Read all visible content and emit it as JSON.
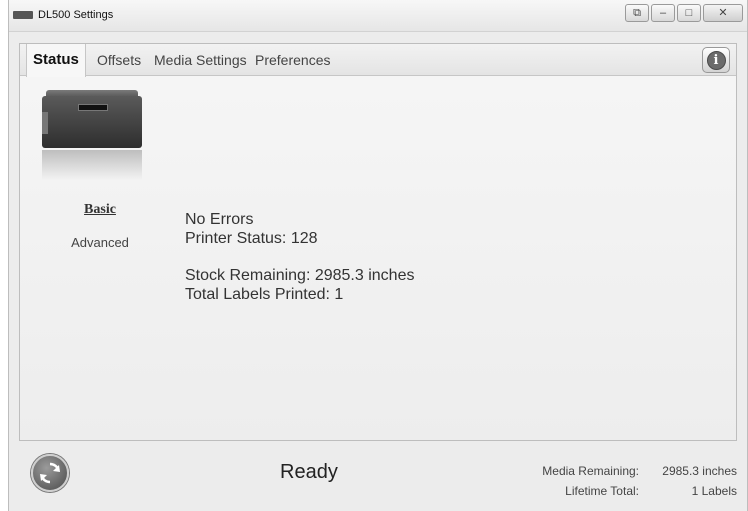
{
  "window": {
    "title": "DL500 Settings",
    "controls": {
      "restore": "⧉",
      "minimize": "–",
      "maximize": "□",
      "close": "✕"
    }
  },
  "tabs": [
    {
      "label": "Status",
      "active": true
    },
    {
      "label": "Offsets",
      "active": false
    },
    {
      "label": "Media Settings",
      "active": false
    },
    {
      "label": "Preferences",
      "active": false
    }
  ],
  "info_button": {
    "glyph": "i",
    "icon": "info-icon"
  },
  "printer_panel": {
    "image": "printer-image",
    "basic_link": "Basic",
    "advanced_link": "Advanced"
  },
  "status": {
    "errors": "No Errors",
    "printer_status": "Printer Status:  128",
    "stock_remaining": "Stock Remaining: 2985.3 inches",
    "total_labels": "Total Labels Printed:  1"
  },
  "footer": {
    "refresh_icon": "refresh-icon",
    "state": "Ready",
    "media_remaining_label": "Media Remaining:",
    "media_remaining_value": "2985.3 inches",
    "lifetime_total_label": "Lifetime Total:",
    "lifetime_total_value": "1 Labels"
  }
}
